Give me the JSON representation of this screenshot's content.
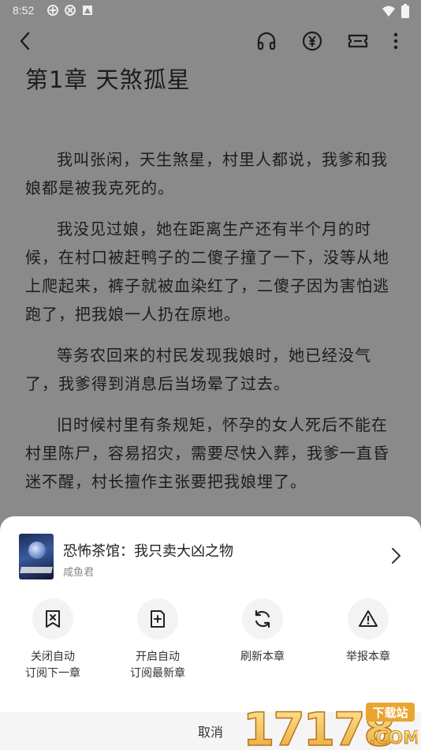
{
  "status_bar": {
    "time": "8:52"
  },
  "toolbar": {
    "back_icon": "chevron-left-icon",
    "listen_icon": "headphones-icon",
    "yuan_icon": "yuan-coin-icon",
    "ticket_icon": "ticket-icon",
    "more_icon": "more-vertical-icon"
  },
  "reader": {
    "chapter_title": "第1章  天煞孤星",
    "paragraphs": [
      "我叫张闲，天生煞星，村里人都说，我爹和我娘都是被我克死的。",
      "我没见过娘，她在距离生产还有半个月的时候，在村口被赶鸭子的二傻子撞了一下，没等从地上爬起来，裤子就被血染红了，二傻子因为害怕逃跑了，把我娘一人扔在原地。",
      "等务农回来的村民发现我娘时，她已经没气了，我爹得到消息后当场晕了过去。",
      "旧时候村里有条规矩，怀孕的女人死后不能在村里陈尸，容易招灾，需要尽快入葬，我爹一直昏迷不醒，村长擅作主张要把我娘埋了。"
    ]
  },
  "sheet": {
    "book_title": "恐怖茶馆：我只卖大凶之物",
    "book_author": "咸鱼君",
    "actions": [
      {
        "label": "关闭自动\n订阅下一章",
        "icon": "close-subscribe-icon"
      },
      {
        "label": "开启自动\n订阅最新章",
        "icon": "add-subscribe-icon"
      },
      {
        "label": "刷新本章",
        "icon": "refresh-icon"
      },
      {
        "label": "举报本章",
        "icon": "warning-icon"
      }
    ],
    "cancel_label": "取消"
  },
  "watermark": {
    "text": "17178",
    "badge": "下载站",
    "suffix": ".COM"
  },
  "colors": {
    "overlay_bg": "#8a8a8a",
    "sheet_bg": "#ffffff",
    "action_circle_bg": "#f3f3f3"
  }
}
